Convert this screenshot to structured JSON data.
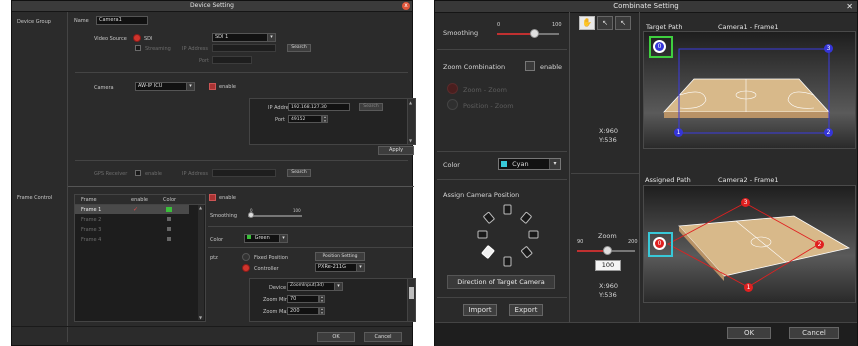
{
  "left": {
    "title": "Device Setting",
    "close": "x",
    "nav": {
      "device_group": "Device Group",
      "frame_control": "Frame Control"
    },
    "name": {
      "label": "Name",
      "value": "Camera1"
    },
    "video_source": {
      "label": "Video Source",
      "sdi_label": "SDI",
      "sdi_value": "SDI 1",
      "streaming_label": "Streaming",
      "ip_label": "IP Address",
      "port_label": "Port",
      "search": "Search"
    },
    "camera": {
      "label": "Camera",
      "value": "AW-IP ICU",
      "enable": "enable",
      "ip_label": "IP Address",
      "ip_value": "192.168.127.30",
      "search": "Search",
      "port_label": "Port",
      "port_value": "49152",
      "apply": "Apply"
    },
    "gps": {
      "label": "GPS Receiver",
      "enable": "enable",
      "ip_label": "IP Address",
      "search": "Search"
    },
    "frame_table": {
      "headers": [
        "Frame",
        "enable",
        "Color"
      ],
      "rows": [
        {
          "name": "Frame 1",
          "enable": "✓",
          "color": "#3bbf3b"
        },
        {
          "name": "Frame 2",
          "enable": "",
          "color": ""
        },
        {
          "name": "Frame 3",
          "enable": "",
          "color": ""
        },
        {
          "name": "Frame 4",
          "enable": "",
          "color": ""
        }
      ]
    },
    "frame_enable": "enable",
    "smoothing": {
      "label": "Smoothing",
      "min": "0",
      "max": "100"
    },
    "color": {
      "label": "Color",
      "value": "Green"
    },
    "ptz": {
      "label": "ptz",
      "fixed": "Fixed Position",
      "fixed_btn": "Position Setting",
      "controller": "Controller",
      "controller_value": "PXRe-211G"
    },
    "zoom": {
      "device_label": "Device",
      "device_value": "ZoomInput(3d)",
      "zoom_min_label": "Zoom Min",
      "zoom_min_value": "70",
      "zoom_max_label": "Zoom Max",
      "zoom_max_value": "200"
    },
    "ok": "OK",
    "cancel": "Cancel"
  },
  "right": {
    "title": "Combinate Setting",
    "close": "✕",
    "smoothing": {
      "label": "Smoothing",
      "min": "0",
      "max": "100",
      "level_pct": 60
    },
    "zoom_combination": {
      "label": "Zoom Combination",
      "enable": "enable",
      "opt1": "Zoom - Zoom",
      "opt2": "Position - Zoom"
    },
    "color": {
      "label": "Color",
      "value": "Cyan"
    },
    "assign": {
      "label": "Assign Camera Position",
      "direction": "Direction of Target Camera"
    },
    "import": "Import",
    "export": "Export",
    "target": {
      "label": "Target Path",
      "frame": "Camera1 - Frame1",
      "x": "X:960",
      "y": "Y:536",
      "points": [
        "0",
        "1",
        "2",
        "3"
      ]
    },
    "assigned": {
      "label": "Assigned Path",
      "frame": "Camera2 - Frame1",
      "x": "X:960",
      "y": "Y:536",
      "points": [
        "0",
        "1",
        "2",
        "3"
      ]
    },
    "zoom": {
      "label": "Zoom",
      "min": "90",
      "max": "200",
      "value": "100"
    },
    "ok": "OK",
    "cancel": "Cancel",
    "colors": {
      "target_frame": "#3a3adf",
      "assigned_frame": "#e02020",
      "green_box": "#3fcf3f",
      "cyan_box": "#38c8d8",
      "court": "#d8b98a"
    }
  }
}
